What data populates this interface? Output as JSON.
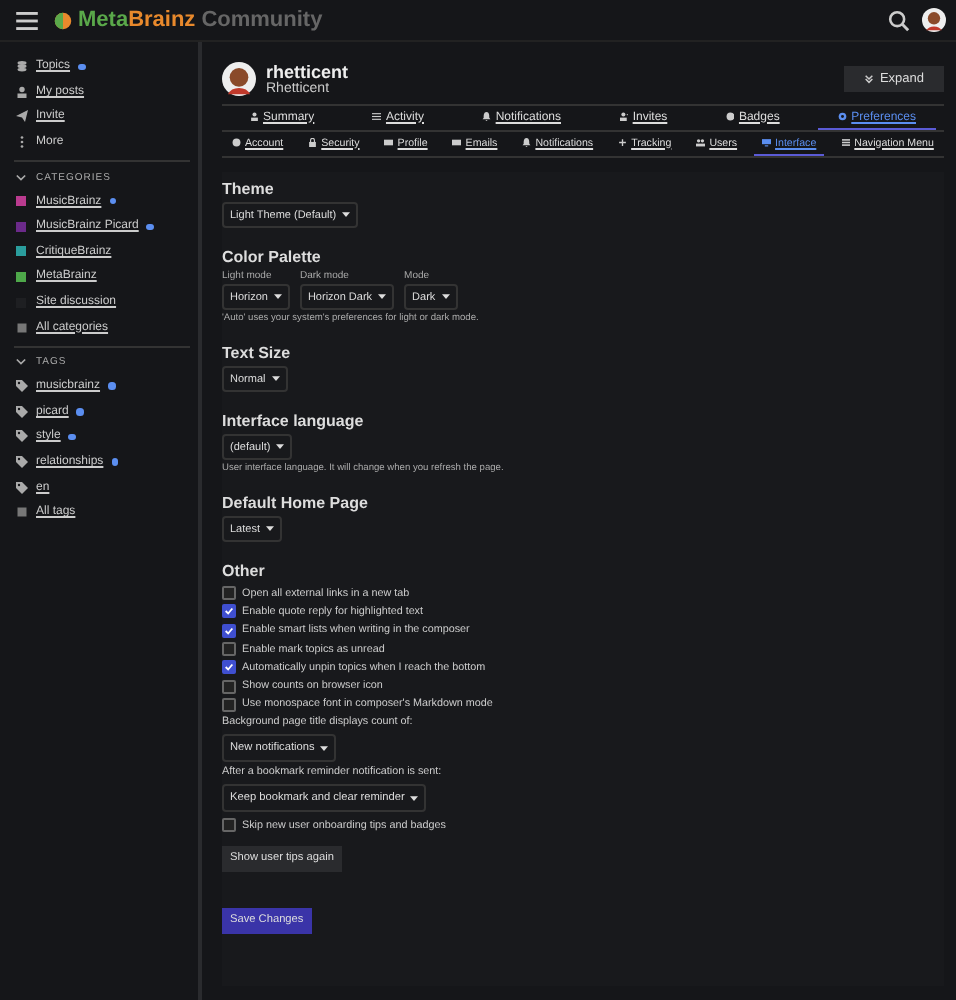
{
  "header": {
    "logo_a": "Meta",
    "logo_b": "Brainz",
    "logo_suffix": "Community"
  },
  "sidebar": {
    "items": [
      {
        "label": "Topics",
        "unread": true
      },
      {
        "label": "My posts",
        "unread": false
      },
      {
        "label": "Invite",
        "unread": false
      },
      {
        "label": "More",
        "unread": false
      }
    ],
    "categories": {
      "title": "CATEGORIES",
      "expanded": true,
      "items": [
        {
          "kind": "category",
          "label": "MusicBrainz",
          "color": "#ba3b8f",
          "unread": true
        },
        {
          "kind": "category",
          "label": "MusicBrainz Picard",
          "color": "#6b2a8a",
          "unread": true
        },
        {
          "kind": "category",
          "label": "CritiqueBrainz",
          "color": "#2a9d9d",
          "unread": false
        },
        {
          "kind": "category",
          "label": "MetaBrainz",
          "color": "#4ea84a",
          "unread": false
        },
        {
          "kind": "category",
          "label": "Site discussion",
          "color": "#1e1f22",
          "unread": false
        },
        {
          "kind": "all",
          "label": "All categories",
          "unread": false
        }
      ]
    },
    "tags": {
      "title": "TAGS",
      "expanded": true,
      "items": [
        {
          "kind": "tag",
          "label": "musicbrainz",
          "unread": true
        },
        {
          "kind": "tag",
          "label": "picard",
          "unread": true
        },
        {
          "kind": "tag",
          "label": "style",
          "unread": true
        },
        {
          "kind": "tag",
          "label": "relationships",
          "unread": true
        },
        {
          "kind": "tag",
          "label": "en",
          "unread": false
        },
        {
          "kind": "all",
          "label": "All tags",
          "unread": false
        }
      ]
    }
  },
  "user": {
    "username": "rhetticent",
    "name": "Rhetticent",
    "expand_button": "Expand"
  },
  "tabs": [
    {
      "label": "Summary",
      "selected": false
    },
    {
      "label": "Activity",
      "selected": false
    },
    {
      "label": "Notifications",
      "selected": false
    },
    {
      "label": "Invites",
      "selected": false
    },
    {
      "label": "Badges",
      "selected": false
    },
    {
      "label": "Preferences",
      "selected": true
    }
  ],
  "subtabs": [
    {
      "label": "Account",
      "selected": false
    },
    {
      "label": "Security",
      "selected": false
    },
    {
      "label": "Profile",
      "selected": false
    },
    {
      "label": "Emails",
      "selected": false
    },
    {
      "label": "Notifications",
      "selected": false
    },
    {
      "label": "Tracking",
      "selected": false
    },
    {
      "label": "Users",
      "selected": false
    },
    {
      "label": "Interface",
      "selected": true
    },
    {
      "label": "Navigation Menu",
      "selected": false
    }
  ],
  "sections": [
    {
      "title": "Theme",
      "fields": [
        {
          "value": "Light Theme (Default)"
        }
      ]
    },
    {
      "title": "Color Palette",
      "fields": [
        {
          "label": "Light mode",
          "value": "Horizon"
        },
        {
          "label": "Dark mode",
          "value": "Horizon Dark"
        },
        {
          "label": "Mode",
          "value": "Dark"
        }
      ],
      "hint": "'Auto' uses your system's preferences for light or dark mode."
    },
    {
      "title": "Text Size",
      "fields": [
        {
          "value": "Normal"
        }
      ]
    },
    {
      "title": "Interface language",
      "fields": [
        {
          "value": "(default)"
        }
      ],
      "hint": "User interface language. It will change when you refresh the page."
    },
    {
      "title": "Default Home Page",
      "fields": [
        {
          "value": "Latest"
        }
      ]
    }
  ],
  "other": {
    "title": "Other",
    "items": [
      {
        "kind": "checkbox",
        "label": "Open all external links in a new tab",
        "checked": false
      },
      {
        "kind": "checkbox",
        "label": "Enable quote reply for highlighted text",
        "checked": true
      },
      {
        "kind": "checkbox",
        "label": "Enable smart lists when writing in the composer",
        "checked": true
      },
      {
        "kind": "checkbox",
        "label": "Enable mark topics as unread",
        "checked": false
      },
      {
        "kind": "checkbox",
        "label": "Automatically unpin topics when I reach the bottom",
        "checked": true
      },
      {
        "kind": "checkbox",
        "label": "Show counts on browser icon",
        "checked": false
      },
      {
        "kind": "checkbox",
        "label": "Use monospace font in composer's Markdown mode",
        "checked": false
      },
      {
        "kind": "select",
        "label": "Background page title displays count of:",
        "value": "New notifications"
      },
      {
        "kind": "select",
        "label": "After a bookmark reminder notification is sent:",
        "value": "Keep bookmark and clear reminder"
      },
      {
        "kind": "checkbox",
        "label": "Skip new user onboarding tips and badges",
        "checked": false
      },
      {
        "kind": "button",
        "label": "Show user tips again"
      }
    ]
  },
  "save_button": "Save Changes"
}
